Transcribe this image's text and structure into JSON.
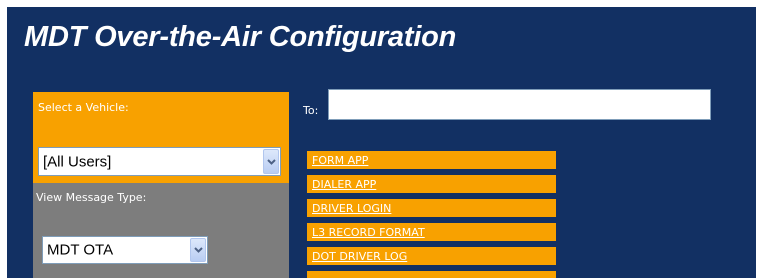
{
  "page": {
    "title": "MDT Over-the-Air Configuration"
  },
  "vehicle_panel": {
    "label": "Select a Vehicle:",
    "selected": "[All Users]"
  },
  "message_type_panel": {
    "label": "View Message Type:",
    "selected": "MDT OTA"
  },
  "to_field": {
    "label": "To:",
    "value": ""
  },
  "menu": {
    "items": [
      {
        "label": "FORM APP"
      },
      {
        "label": "DIALER APP"
      },
      {
        "label": "DRIVER LOGIN"
      },
      {
        "label": "L3 RECORD FORMAT"
      },
      {
        "label": "DOT DRIVER LOG"
      }
    ]
  },
  "colors": {
    "background": "#123063",
    "accent_orange": "#f8a100",
    "panel_gray": "#7d7d7d",
    "text_light": "#ffffff"
  }
}
